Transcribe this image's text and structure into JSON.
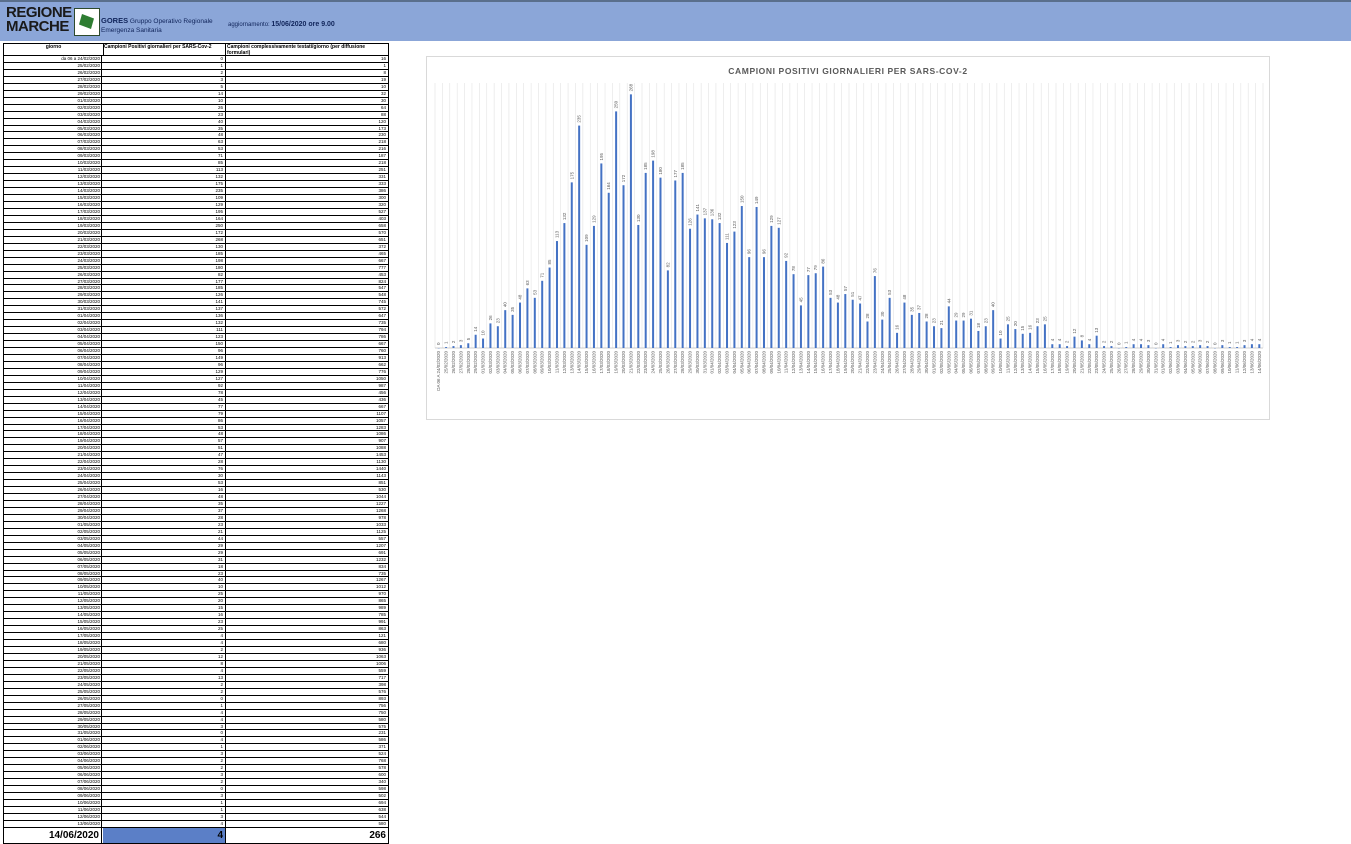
{
  "header": {
    "logo_line1": "REGIONE",
    "logo_line2": "MARCHE",
    "org_short": "GORES",
    "org_line1": "Gruppo Operativo Regionale",
    "org_line2": "Emergenza Sanitaria",
    "update_label": "aggiornamento:",
    "update_value": "15/06/2020 ore 9.00"
  },
  "table": {
    "col_day": "giorno",
    "col_positives": "Campioni Positivi giornalieri per SARS-Cov-2",
    "col_tested": "Campioni complessivamente testati/giorno (per diffusione formulari)",
    "rows": [
      [
        "da 06 a 24/02/2020",
        "0",
        "16"
      ],
      [
        "25/02/2020",
        "1",
        "1"
      ],
      [
        "26/02/2020",
        "2",
        "8"
      ],
      [
        "27/02/2020",
        "3",
        "19"
      ],
      [
        "28/02/2020",
        "5",
        "10"
      ],
      [
        "29/02/2020",
        "14",
        "32"
      ],
      [
        "01/03/2020",
        "10",
        "30"
      ],
      [
        "02/03/2020",
        "26",
        "64"
      ],
      [
        "03/03/2020",
        "23",
        "88"
      ],
      [
        "04/03/2020",
        "40",
        "120"
      ],
      [
        "05/03/2020",
        "35",
        "173"
      ],
      [
        "06/03/2020",
        "48",
        "230"
      ],
      [
        "07/03/2020",
        "63",
        "218"
      ],
      [
        "08/03/2020",
        "53",
        "216"
      ],
      [
        "09/03/2020",
        "71",
        "187"
      ],
      [
        "10/03/2020",
        "85",
        "218"
      ],
      [
        "11/03/2020",
        "113",
        "251"
      ],
      [
        "12/03/2020",
        "132",
        "331"
      ],
      [
        "13/03/2020",
        "175",
        "333"
      ],
      [
        "14/03/2020",
        "235",
        "386"
      ],
      [
        "15/03/2020",
        "109",
        "300"
      ],
      [
        "16/03/2020",
        "129",
        "320"
      ],
      [
        "17/03/2020",
        "195",
        "527"
      ],
      [
        "18/03/2020",
        "164",
        "403"
      ],
      [
        "19/03/2020",
        "250",
        "658"
      ],
      [
        "20/03/2020",
        "172",
        "570"
      ],
      [
        "21/03/2020",
        "268",
        "651"
      ],
      [
        "22/03/2020",
        "130",
        "372"
      ],
      [
        "23/03/2020",
        "185",
        "465"
      ],
      [
        "24/03/2020",
        "198",
        "667"
      ],
      [
        "25/03/2020",
        "180",
        "777"
      ],
      [
        "26/03/2020",
        "82",
        "453"
      ],
      [
        "27/03/2020",
        "177",
        "824"
      ],
      [
        "28/03/2020",
        "185",
        "547"
      ],
      [
        "29/03/2020",
        "126",
        "548"
      ],
      [
        "30/03/2020",
        "141",
        "745"
      ],
      [
        "31/03/2020",
        "137",
        "572"
      ],
      [
        "01/04/2020",
        "136",
        "647"
      ],
      [
        "02/04/2020",
        "132",
        "735"
      ],
      [
        "03/04/2020",
        "111",
        "794"
      ],
      [
        "04/04/2020",
        "123",
        "786"
      ],
      [
        "05/04/2020",
        "150",
        "667"
      ],
      [
        "06/04/2020",
        "96",
        "760"
      ],
      [
        "07/04/2020",
        "149",
        "913"
      ],
      [
        "08/04/2020",
        "96",
        "662"
      ],
      [
        "09/04/2020",
        "129",
        "776"
      ],
      [
        "10/04/2020",
        "127",
        "1050"
      ],
      [
        "11/04/2020",
        "92",
        "987"
      ],
      [
        "12/04/2020",
        "78",
        "456"
      ],
      [
        "13/04/2020",
        "45",
        "436"
      ],
      [
        "14/04/2020",
        "77",
        "667"
      ],
      [
        "15/04/2020",
        "79",
        "1107"
      ],
      [
        "16/04/2020",
        "86",
        "1057"
      ],
      [
        "17/04/2020",
        "53",
        "1283"
      ],
      [
        "18/04/2020",
        "48",
        "1086"
      ],
      [
        "19/04/2020",
        "57",
        "907"
      ],
      [
        "20/04/2020",
        "51",
        "1088"
      ],
      [
        "21/04/2020",
        "47",
        "1453"
      ],
      [
        "22/04/2020",
        "28",
        "1130"
      ],
      [
        "23/04/2020",
        "76",
        "1440"
      ],
      [
        "24/04/2020",
        "30",
        "1143"
      ],
      [
        "25/04/2020",
        "53",
        "851"
      ],
      [
        "26/04/2020",
        "16",
        "530"
      ],
      [
        "27/04/2020",
        "48",
        "1044"
      ],
      [
        "28/04/2020",
        "35",
        "1227"
      ],
      [
        "29/04/2020",
        "37",
        "1268"
      ],
      [
        "30/04/2020",
        "28",
        "978"
      ],
      [
        "01/05/2020",
        "23",
        "1033"
      ],
      [
        "02/05/2020",
        "21",
        "1125"
      ],
      [
        "03/05/2020",
        "44",
        "557"
      ],
      [
        "04/05/2020",
        "29",
        "1207"
      ],
      [
        "05/05/2020",
        "29",
        "691"
      ],
      [
        "06/05/2020",
        "31",
        "1232"
      ],
      [
        "07/05/2020",
        "18",
        "834"
      ],
      [
        "08/05/2020",
        "23",
        "735"
      ],
      [
        "09/05/2020",
        "40",
        "1267"
      ],
      [
        "10/05/2020",
        "10",
        "1012"
      ],
      [
        "11/05/2020",
        "25",
        "970"
      ],
      [
        "12/05/2020",
        "20",
        "865"
      ],
      [
        "13/05/2020",
        "15",
        "989"
      ],
      [
        "14/05/2020",
        "16",
        "785"
      ],
      [
        "15/05/2020",
        "23",
        "991"
      ],
      [
        "16/05/2020",
        "25",
        "863"
      ],
      [
        "17/05/2020",
        "4",
        "121"
      ],
      [
        "18/05/2020",
        "4",
        "680"
      ],
      [
        "19/05/2020",
        "2",
        "936"
      ],
      [
        "20/05/2020",
        "12",
        "1063"
      ],
      [
        "21/05/2020",
        "8",
        "1006"
      ],
      [
        "22/05/2020",
        "4",
        "559"
      ],
      [
        "23/05/2020",
        "13",
        "717"
      ],
      [
        "24/05/2020",
        "2",
        "398"
      ],
      [
        "25/05/2020",
        "2",
        "576"
      ],
      [
        "26/05/2020",
        "0",
        "893"
      ],
      [
        "27/05/2020",
        "1",
        "756"
      ],
      [
        "28/05/2020",
        "4",
        "750"
      ],
      [
        "29/05/2020",
        "4",
        "580"
      ],
      [
        "30/05/2020",
        "3",
        "575"
      ],
      [
        "31/05/2020",
        "0",
        "231"
      ],
      [
        "01/06/2020",
        "4",
        "586"
      ],
      [
        "02/06/2020",
        "1",
        "371"
      ],
      [
        "03/06/2020",
        "3",
        "524"
      ],
      [
        "04/06/2020",
        "2",
        "768"
      ],
      [
        "05/06/2020",
        "2",
        "578"
      ],
      [
        "06/06/2020",
        "3",
        "600"
      ],
      [
        "07/06/2020",
        "2",
        "340"
      ],
      [
        "08/06/2020",
        "0",
        "598"
      ],
      [
        "09/06/2020",
        "3",
        "502"
      ],
      [
        "10/06/2020",
        "1",
        "694"
      ],
      [
        "11/06/2020",
        "1",
        "638"
      ],
      [
        "12/06/2020",
        "3",
        "544"
      ],
      [
        "13/06/2020",
        "4",
        "580"
      ]
    ],
    "footer": {
      "day": "14/06/2020",
      "positives": "4",
      "tested": "266"
    }
  },
  "chart_data": {
    "type": "bar",
    "title": "CAMPIONI POSITIVI GIORNALIERI PER SARS-COV-2",
    "color": "#4472c4",
    "categories": [
      "DA 06 A 24/02/2020",
      "25/02/2020",
      "26/02/2020",
      "27/02/2020",
      "28/02/2020",
      "29/02/2020",
      "01/03/2020",
      "02/03/2020",
      "03/03/2020",
      "04/03/2020",
      "05/03/2020",
      "06/03/2020",
      "07/03/2020",
      "08/03/2020",
      "09/03/2020",
      "10/03/2020",
      "11/03/2020",
      "12/03/2020",
      "13/03/2020",
      "14/03/2020",
      "15/03/2020",
      "16/03/2020",
      "17/03/2020",
      "18/03/2020",
      "19/03/2020",
      "20/03/2020",
      "21/03/2020",
      "22/03/2020",
      "23/03/2020",
      "24/03/2020",
      "25/03/2020",
      "26/03/2020",
      "27/03/2020",
      "28/03/2020",
      "29/03/2020",
      "30/03/2020",
      "31/03/2020",
      "01/04/2020",
      "02/04/2020",
      "03/04/2020",
      "04/04/2020",
      "05/04/2020",
      "06/04/2020",
      "07/04/2020",
      "08/04/2020",
      "09/04/2020",
      "10/04/2020",
      "11/04/2020",
      "12/04/2020",
      "13/04/2020",
      "14/04/2020",
      "15/04/2020",
      "16/04/2020",
      "17/04/2020",
      "18/04/2020",
      "19/04/2020",
      "20/04/2020",
      "21/04/2020",
      "22/04/2020",
      "23/04/2020",
      "24/04/2020",
      "25/04/2020",
      "26/04/2020",
      "27/04/2020",
      "28/04/2020",
      "29/04/2020",
      "30/04/2020",
      "01/05/2020",
      "02/05/2020",
      "03/05/2020",
      "04/05/2020",
      "05/05/2020",
      "06/05/2020",
      "07/05/2020",
      "08/05/2020",
      "09/05/2020",
      "10/05/2020",
      "11/05/2020",
      "12/05/2020",
      "13/05/2020",
      "14/05/2020",
      "15/05/2020",
      "16/05/2020",
      "17/05/2020",
      "18/05/2020",
      "19/05/2020",
      "20/05/2020",
      "21/05/2020",
      "22/05/2020",
      "23/05/2020",
      "24/05/2020",
      "25/05/2020",
      "26/05/2020",
      "27/05/2020",
      "28/05/2020",
      "29/05/2020",
      "30/05/2020",
      "31/05/2020",
      "01/06/2020",
      "02/06/2020",
      "03/06/2020",
      "04/06/2020",
      "05/06/2020",
      "06/06/2020",
      "07/06/2020",
      "08/06/2020",
      "09/06/2020",
      "10/06/2020",
      "11/06/2020",
      "12/06/2020",
      "13/06/2020",
      "14/06/2020"
    ],
    "values": [
      0,
      1,
      2,
      3,
      5,
      14,
      10,
      26,
      23,
      40,
      35,
      48,
      63,
      53,
      71,
      85,
      113,
      132,
      175,
      235,
      109,
      129,
      195,
      164,
      250,
      172,
      268,
      130,
      185,
      198,
      180,
      82,
      177,
      185,
      126,
      141,
      137,
      136,
      132,
      111,
      123,
      150,
      96,
      149,
      96,
      129,
      127,
      92,
      78,
      45,
      77,
      79,
      86,
      53,
      48,
      57,
      51,
      47,
      28,
      76,
      30,
      53,
      16,
      48,
      35,
      37,
      28,
      23,
      21,
      44,
      29,
      29,
      31,
      18,
      23,
      40,
      10,
      25,
      20,
      15,
      16,
      23,
      25,
      4,
      4,
      2,
      12,
      8,
      4,
      13,
      2,
      2,
      0,
      1,
      4,
      4,
      3,
      0,
      4,
      1,
      3,
      2,
      2,
      3,
      2,
      0,
      3,
      1,
      1,
      3,
      4,
      4
    ],
    "ylim": [
      0,
      280
    ],
    "grid": true,
    "legend": "none"
  }
}
